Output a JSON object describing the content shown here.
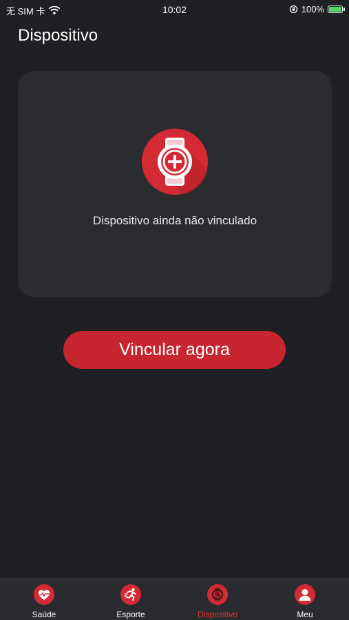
{
  "status_bar": {
    "carrier": "无 SIM 卡",
    "time": "10:02",
    "battery_percent": "100%",
    "battery_level": 1.0,
    "battery_color": "#4cd964"
  },
  "header": {
    "title": "Dispositivo"
  },
  "device_card": {
    "icon": "watch-add-icon",
    "message": "Dispositivo ainda não vinculado"
  },
  "bind_button": {
    "label": "Vincular agora"
  },
  "tabs": [
    {
      "label": "Saúde",
      "icon": "heart-pulse-icon",
      "active": false
    },
    {
      "label": "Esporte",
      "icon": "runner-icon",
      "active": false
    },
    {
      "label": "Dispositivo",
      "icon": "watch-icon",
      "active": true
    },
    {
      "label": "Meu",
      "icon": "user-icon",
      "active": false
    }
  ],
  "colors": {
    "background": "#1f2023",
    "card": "#2b2c30",
    "accent": "#c7252f",
    "active_tab": "#e0313b",
    "tab_bar": "#2a2b2f"
  }
}
